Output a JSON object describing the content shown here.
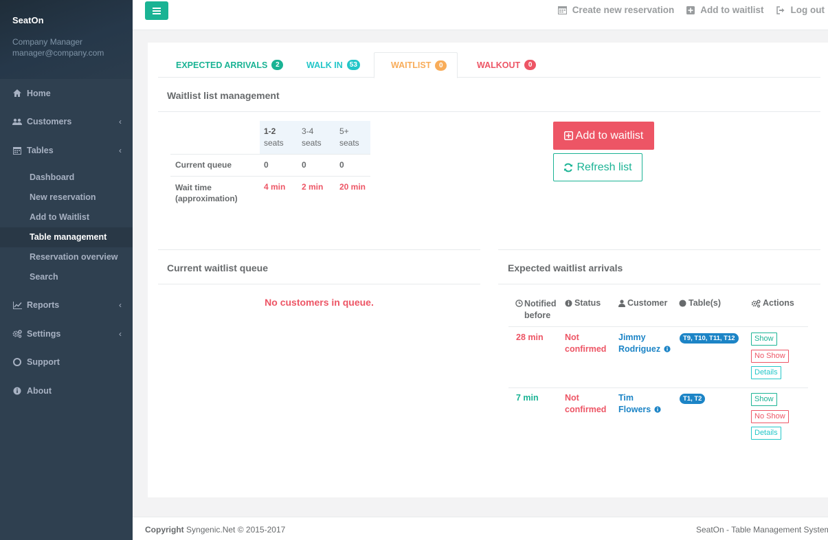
{
  "sidebar": {
    "brand": "SeatOn",
    "role": "Company Manager",
    "email": "manager@company.com",
    "nav": {
      "home": "Home",
      "customers": "Customers",
      "tables": "Tables",
      "reports": "Reports",
      "settings": "Settings",
      "support": "Support",
      "about": "About"
    },
    "tables_sub": [
      "Dashboard",
      "New reservation",
      "Add to Waitlist",
      "Table management",
      "Reservation overview",
      "Search"
    ]
  },
  "topbar": {
    "create_reservation": "Create new reservation",
    "add_waitlist": "Add to waitlist",
    "logout": "Log out"
  },
  "tabs": [
    {
      "label": "EXPECTED ARRIVALS",
      "count": "2"
    },
    {
      "label": "WALK IN",
      "count": "53"
    },
    {
      "label": "WAITLIST",
      "count": "0"
    },
    {
      "label": "WALKOUT",
      "count": "0"
    }
  ],
  "management": {
    "title": "Waitlist list management",
    "col1_a": "1-2",
    "col1_b": "seats",
    "col2_a": "3-4",
    "col2_b": "seats",
    "col3_a": "5+",
    "col3_b": "seats",
    "queue_label": "Current queue",
    "queue_values": [
      "0",
      "0",
      "0"
    ],
    "wait_label_a": "Wait time",
    "wait_label_b": "(approximation)",
    "wait_values": [
      "4 min",
      "2 min",
      "20 min"
    ],
    "add_button": "Add to waitlist",
    "refresh_button": "Refresh list"
  },
  "queue": {
    "title": "Current waitlist queue",
    "empty": "No customers in queue."
  },
  "arrivals": {
    "title": "Expected waitlist arrivals",
    "headers": {
      "notified_a": "Notified",
      "notified_b": "before",
      "status": "Status",
      "customer": "Customer",
      "tables": "Table(s)",
      "actions": "Actions"
    },
    "rows": [
      {
        "notified": "28 min",
        "status_a": "Not",
        "status_b": "confirmed",
        "name_a": "Jimmy",
        "name_b": "Rodriguez",
        "tables": "T9, T10, T11, T12"
      },
      {
        "notified": "7 min",
        "status_a": "Not",
        "status_b": "confirmed",
        "name_a": "Tim",
        "name_b": "Flowers",
        "tables": "T1, T2"
      }
    ],
    "btn_show": "Show",
    "btn_noshow": "No Show",
    "btn_details": "Details"
  },
  "footer": {
    "copyright_label": "Copyright",
    "copyright_text": "Syngenic.Net © 2015-2017",
    "right": "SeatOn - Table Management System"
  },
  "colors": {
    "green": "#1ab394",
    "teal": "#23c6c8",
    "orange": "#f8ac59",
    "red": "#ed5565",
    "blue": "#1c84c6",
    "sidebar": "#2f4050"
  }
}
